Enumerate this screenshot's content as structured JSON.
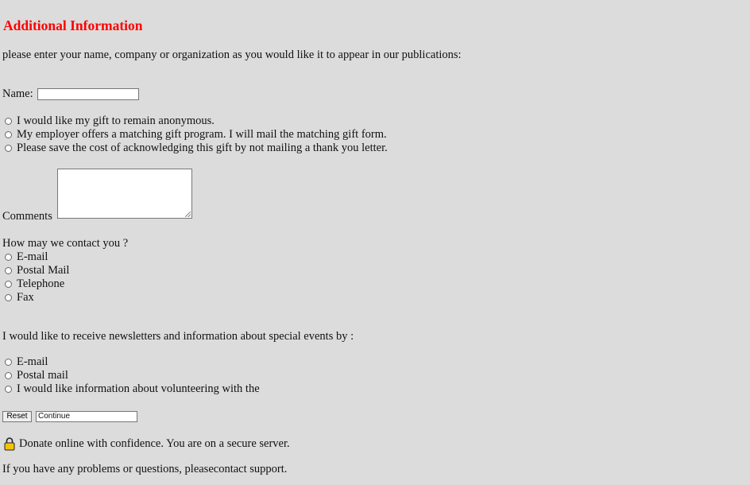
{
  "title": "Additional Information",
  "intro": "please enter your name, company or organization as you would like it to appear in our publications:",
  "name_label": "Name:",
  "name_value": "",
  "gift_options": [
    "I would like my gift to remain anonymous.",
    "My employer offers a matching gift program. I will mail the matching gift form.",
    "Please save the cost of acknowledging this gift by not mailing a thank you letter."
  ],
  "comments_label": "Comments",
  "comments_value": "",
  "contact_question": "How may we contact you ?",
  "contact_options": [
    "E-mail",
    "Postal Mail",
    "Telephone",
    "Fax"
  ],
  "newsletter_question": "I would like to receive newsletters and information about special events by :",
  "newsletter_options": [
    "E-mail",
    "Postal mail",
    "I would like information about volunteering with the"
  ],
  "buttons": {
    "reset": "Reset",
    "continue": "Continue"
  },
  "secure_note": "Donate online with confidence. You are on a secure server.",
  "support_note": "If you have any problems or questions, pleasecontact support.",
  "colors": {
    "background": "#dcdcdc",
    "title": "#ff0000",
    "lock_body": "#f5c400"
  }
}
